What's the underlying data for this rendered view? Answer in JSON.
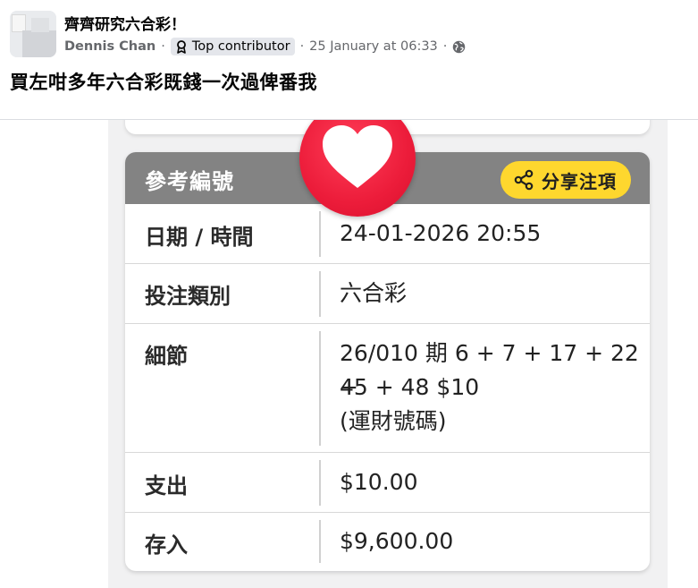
{
  "post": {
    "group_name": "齊齊研究六合彩！",
    "author": "Dennis Chan",
    "badge_label": "Top contributor",
    "date": "25 January at 06:33",
    "privacy_icon": "globe-icon",
    "text": "買左咁多年六合彩既錢一次過俾番我"
  },
  "ticket": {
    "header_label": "參考編號",
    "share_label": "分享注項",
    "share_icon": "share-icon",
    "reaction_icon": "heart-icon",
    "rows": [
      {
        "key": "日期 / 時間",
        "value_lines": [
          "24-01-2026 20:55"
        ]
      },
      {
        "key": "投注類別",
        "value_lines": [
          "六合彩"
        ]
      },
      {
        "key": "細節",
        "value_lines": [
          "26/010 期 6 + 7 + 17 + 22 +",
          "45 + 48 $10",
          "(運財號碼)"
        ]
      },
      {
        "key": "支出",
        "value_lines": [
          "$10.00"
        ]
      },
      {
        "key": "存入",
        "value_lines": [
          "$9,600.00"
        ]
      }
    ]
  },
  "colors": {
    "header_grey": "#838383",
    "share_yellow": "#fed72e",
    "heart_red": "#ec1c3a",
    "meta_grey": "#65676b"
  }
}
